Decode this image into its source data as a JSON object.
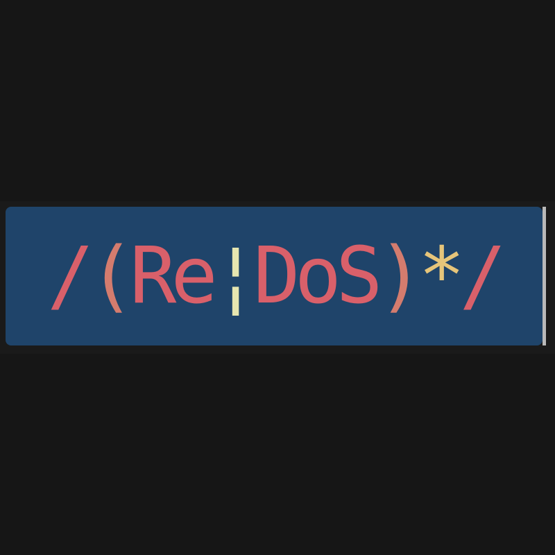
{
  "colors": {
    "background": "#161616",
    "selection": "#1f446a",
    "cursor": "#b9b9b9",
    "delimiter": "#d9606a",
    "paren": "#d47c6e",
    "literal": "#d9606a",
    "alternation": "#e6e6b0",
    "quantifier": "#e6c57a"
  },
  "regex": {
    "open_slash": "/",
    "open_paren": "(",
    "literal_a": "Re",
    "pipe": "¦",
    "literal_b": "DoS",
    "close_paren": ")",
    "star": "*",
    "close_slash": "/"
  }
}
